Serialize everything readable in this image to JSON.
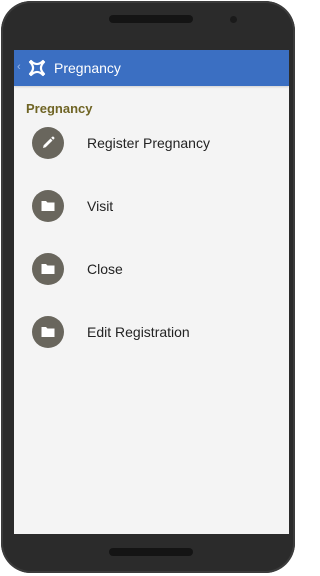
{
  "app": {
    "title": "Pregnancy",
    "back_glyph": "‹",
    "colors": {
      "app_bar": "#3b6fc2",
      "section_title": "#6f6424",
      "item_icon_background": "#69665d",
      "screen_background": "#f4f4f4"
    }
  },
  "section": {
    "title": "Pregnancy"
  },
  "menu": [
    {
      "label": "Register Pregnancy",
      "icon": "pencil-icon"
    },
    {
      "label": "Visit",
      "icon": "folder-icon"
    },
    {
      "label": "Close",
      "icon": "folder-icon"
    },
    {
      "label": "Edit Registration",
      "icon": "folder-icon"
    }
  ]
}
